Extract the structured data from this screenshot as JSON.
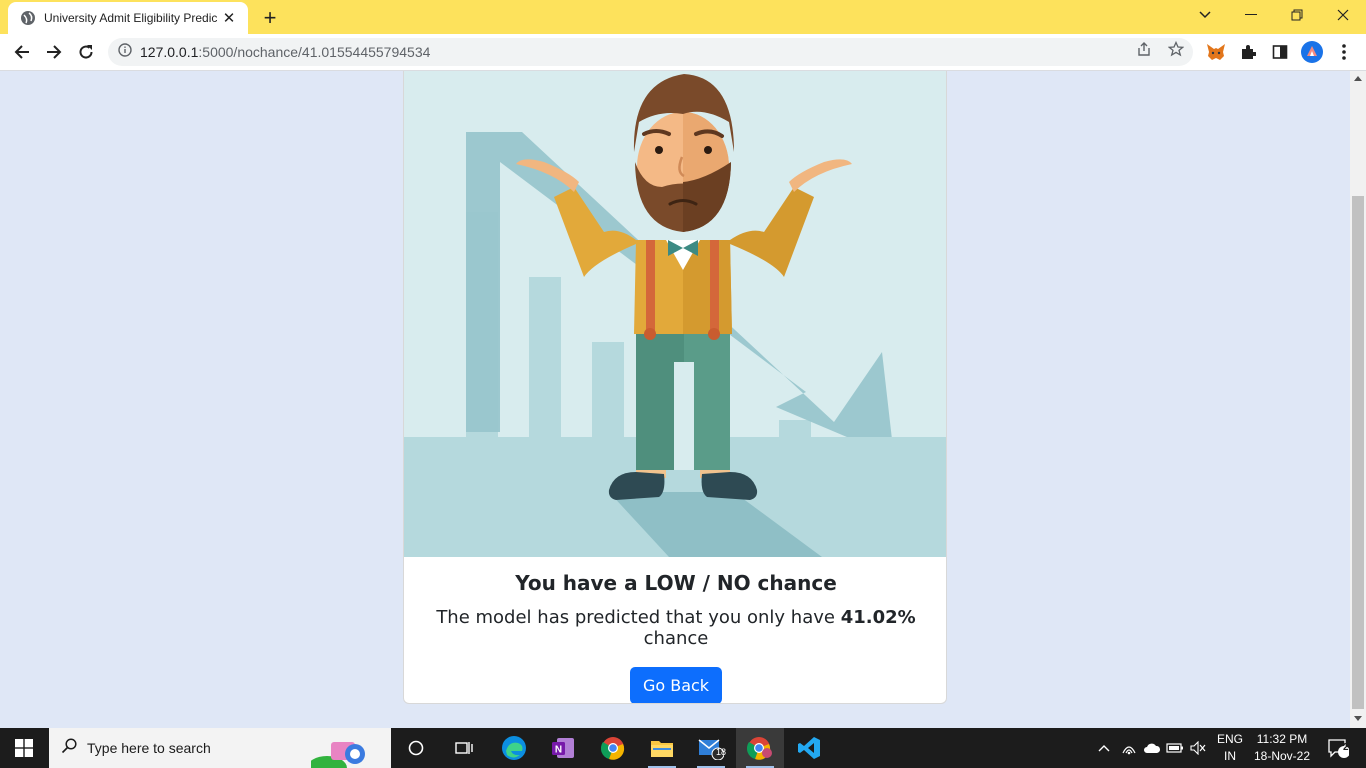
{
  "browser": {
    "tab_title": "University Admit Eligibility Predic",
    "url_host": "127.0.0.1",
    "url_path": ":5000/nochance/41.01554455794534",
    "accent_color": "#fde25c"
  },
  "result": {
    "heading": "You have a LOW / NO chance",
    "text_prefix": "The model has predicted that you only have ",
    "percentage": "41.02%",
    "text_suffix": " chance",
    "button_label": "Go Back",
    "button_color": "#0d6efd"
  },
  "taskbar": {
    "search_placeholder": "Type here to search",
    "lang_line1": "ENG",
    "lang_line2": "IN",
    "time": "11:32 PM",
    "date": "18-Nov-22",
    "mail_badge": "18",
    "notification_count": "2"
  }
}
